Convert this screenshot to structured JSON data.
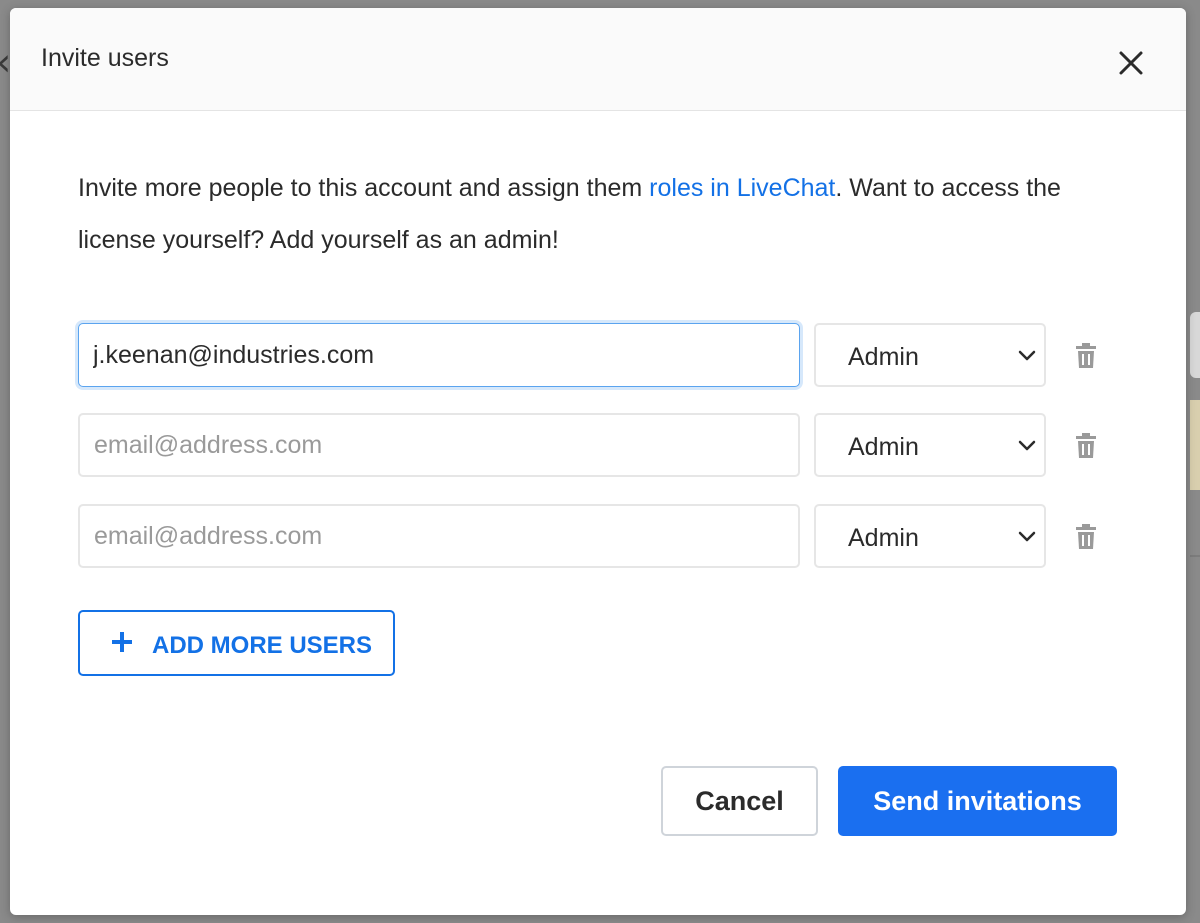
{
  "modal": {
    "title": "Invite users",
    "intro_before": "Invite more people to this account and assign them ",
    "intro_link": "roles in LiveChat",
    "intro_after": ". Want to access the license yourself? Add yourself as an admin!",
    "invite_rows": [
      {
        "email": "j.keenan@industries.com",
        "placeholder": "email@address.com",
        "role": "Admin"
      },
      {
        "email": "",
        "placeholder": "email@address.com",
        "role": "Admin"
      },
      {
        "email": "",
        "placeholder": "email@address.com",
        "role": "Admin"
      }
    ],
    "add_more_label": "ADD MORE USERS",
    "cancel_label": "Cancel",
    "send_label": "Send invitations"
  },
  "icons": {
    "close": "close-icon",
    "role_dropdown": "chevron-down-icon",
    "remove_row": "trash-icon",
    "add": "plus-icon"
  },
  "colors": {
    "accent": "#1a6ff0",
    "link": "#1371e6",
    "focus_border": "#5ba4ef"
  }
}
